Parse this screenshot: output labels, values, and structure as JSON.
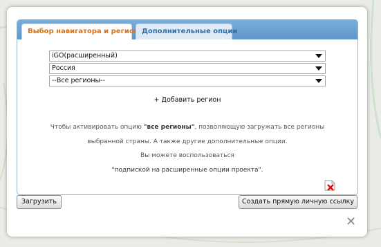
{
  "tabs": {
    "active_label": "Выбор навигатора и региона",
    "inactive_label": "Дополнительные опции"
  },
  "selects": {
    "navigator": "iGO(расширенный)",
    "country": "Россия",
    "region": "--Все регионы--"
  },
  "add_region_label": "+ Добавить регион",
  "info": {
    "line1_pre": "Чтобы активировать опцию ",
    "line1_bold": "\"все регионы\"",
    "line1_post": ", позволяющую загружать все регионы",
    "line2": "выбранной страны. А также другие дополнительные опции.",
    "line3": "Вы можете воспользоваться",
    "line4": "\"подпиской на расширенные опции проекта\"."
  },
  "buttons": {
    "upload_label": "Загрузить",
    "create_link_label": "Создать прямую личную ссылку"
  },
  "icons": {
    "broken_image": "broken-image-icon",
    "close": "close-icon"
  },
  "colors": {
    "tab_bar": "#6aa3d4",
    "active_tab_text": "#e17009",
    "inactive_tab_text": "#2e6ea6"
  }
}
